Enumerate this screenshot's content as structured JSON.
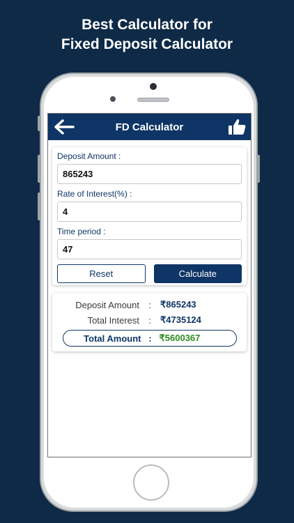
{
  "banner": {
    "line1": "Best Calculator for",
    "line2": "Fixed Deposit Calculator"
  },
  "appbar": {
    "title": "FD Calculator",
    "back_icon": "arrow-left-icon",
    "like_icon": "thumbs-up-icon"
  },
  "form": {
    "deposit_label": "Deposit Amount :",
    "deposit_value": "865243",
    "rate_label": "Rate of Interest(%) :",
    "rate_value": "4",
    "time_label": "Time period :",
    "time_value": "47",
    "reset_label": "Reset",
    "calculate_label": "Calculate"
  },
  "result": {
    "deposit_label": "Deposit Amount",
    "deposit_value": "₹865243",
    "interest_label": "Total Interest",
    "interest_value": "₹4735124",
    "total_label": "Total Amount",
    "total_value": "₹5600367",
    "separator": ":"
  },
  "colors": {
    "background": "#0e2a47",
    "primary": "#0f3566",
    "total_green": "#2e8b1f"
  }
}
